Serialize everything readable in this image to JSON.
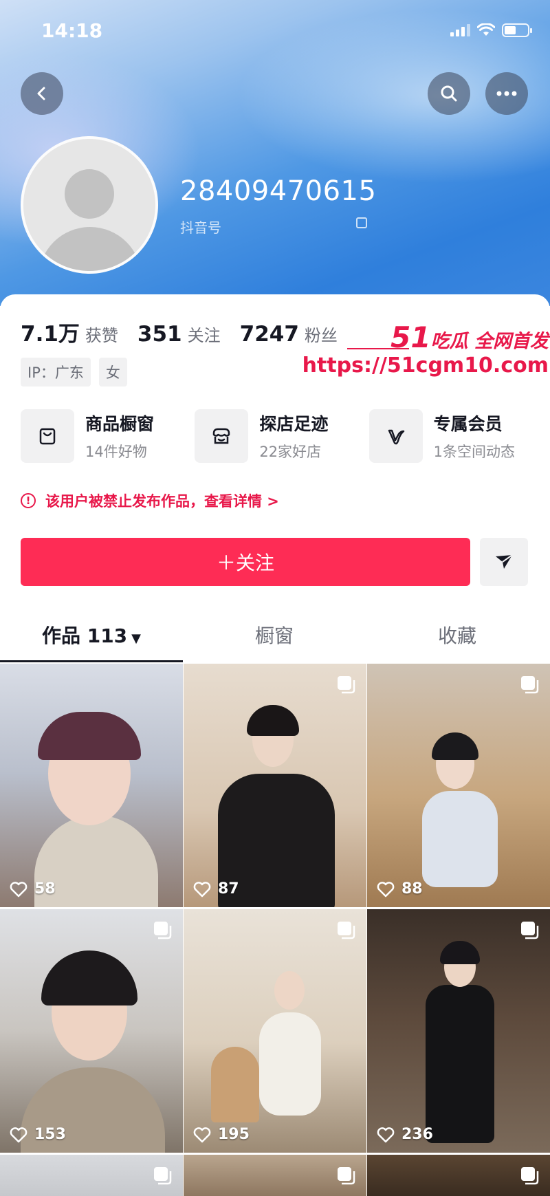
{
  "status_bar": {
    "time": "14:18"
  },
  "profile": {
    "nickname": "28409470615",
    "douyin_id_label": "抖音号",
    "stats": [
      {
        "value": "7.1万",
        "label": "获赞"
      },
      {
        "value": "351",
        "label": "关注"
      },
      {
        "value": "7247",
        "label": "粉丝"
      }
    ],
    "tags": [
      "IP：广东",
      "女"
    ]
  },
  "watermark": {
    "line1_number": "51",
    "line1_text": "吃瓜 全网首发",
    "url": "https://51cgm10.com"
  },
  "features": [
    {
      "title": "商品橱窗",
      "subtitle": "14件好物",
      "icon": "shopping-bag-icon"
    },
    {
      "title": "探店足迹",
      "subtitle": "22家好店",
      "icon": "store-icon"
    },
    {
      "title": "专属会员",
      "subtitle": "1条空间动态",
      "icon": "vip-v-icon"
    }
  ],
  "warning": {
    "text": "该用户被禁止发布作品，查看详情 >"
  },
  "actions": {
    "follow_label": "＋关注"
  },
  "tabs": [
    {
      "label": "作品 113",
      "active": true
    },
    {
      "label": "橱窗",
      "active": false
    },
    {
      "label": "收藏",
      "active": false
    }
  ],
  "videos": [
    {
      "likes": "58"
    },
    {
      "likes": "87"
    },
    {
      "likes": "88"
    },
    {
      "likes": "153"
    },
    {
      "likes": "195"
    },
    {
      "likes": "236"
    }
  ],
  "colors": {
    "accent": "#fe2c55",
    "header_blue": "#2f7fdc",
    "watermark_red": "#e8184a"
  }
}
